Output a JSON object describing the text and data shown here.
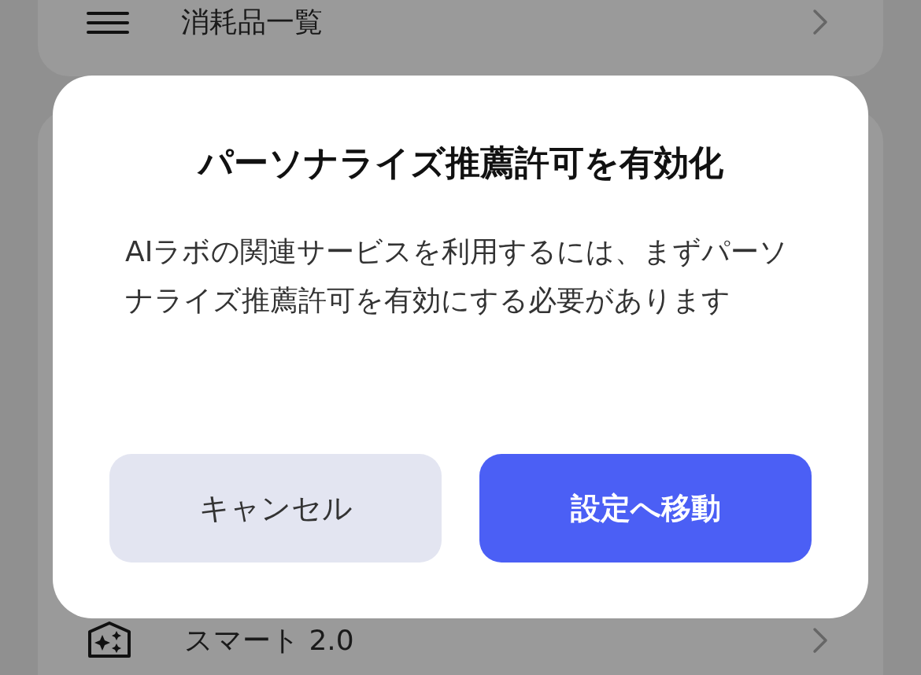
{
  "background_cards": [
    {
      "items": [
        {
          "kind": "list",
          "label": "消耗品一覧"
        }
      ]
    },
    {
      "items": [
        {
          "kind": "sparkle",
          "label": "スマート 2.0"
        }
      ]
    }
  ],
  "dialog": {
    "title": "パーソナライズ推薦許可を有効化",
    "message": "AIラボの関連サービスを利用するには、まずパーソナライズ推薦許可を有効にする必要があります",
    "buttons": [
      {
        "label": "キャンセル",
        "kind": "secondary"
      },
      {
        "label": "設定へ移動",
        "kind": "primary"
      }
    ]
  }
}
